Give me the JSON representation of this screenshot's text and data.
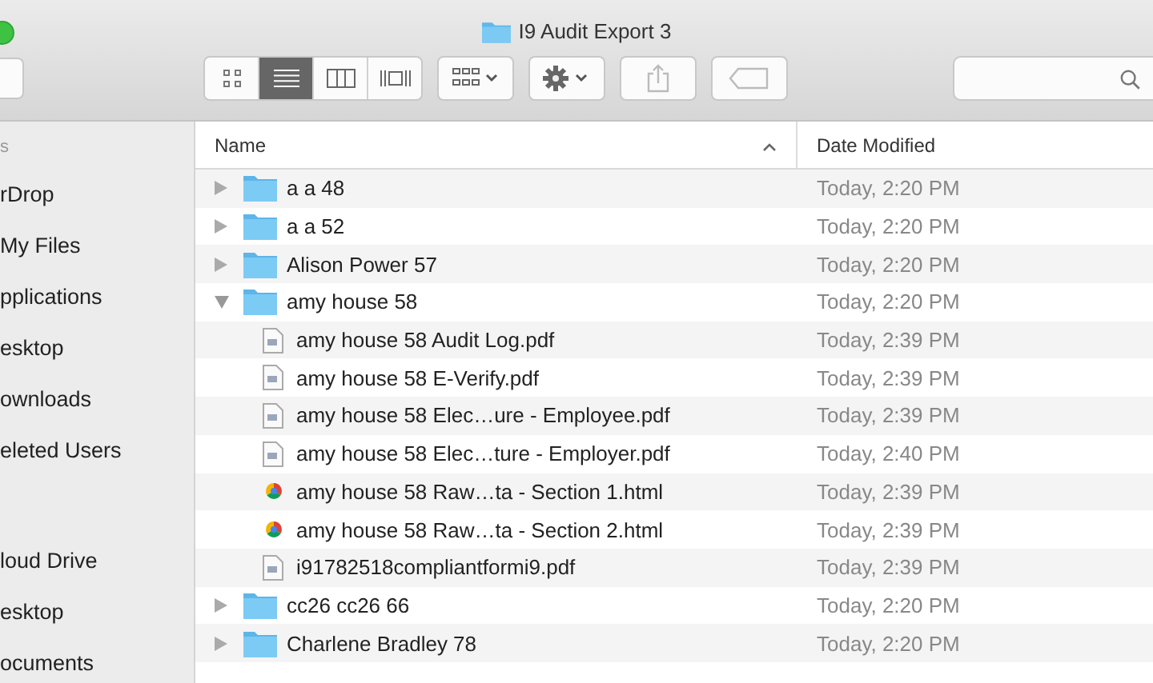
{
  "window": {
    "title": "I9 Audit Export 3"
  },
  "toolbar": {
    "view_modes": [
      {
        "kind": "icons",
        "selected": false
      },
      {
        "kind": "list",
        "selected": true
      },
      {
        "kind": "columns",
        "selected": false
      },
      {
        "kind": "coverflow",
        "selected": false
      }
    ]
  },
  "sidebar": {
    "items": [
      {
        "label": "s",
        "kind": "heading"
      },
      {
        "label": "rDrop",
        "kind": "item"
      },
      {
        "label": "My Files",
        "kind": "item"
      },
      {
        "label": "pplications",
        "kind": "item"
      },
      {
        "label": "esktop",
        "kind": "item"
      },
      {
        "label": "ownloads",
        "kind": "item"
      },
      {
        "label": "eleted Users",
        "kind": "item"
      },
      {
        "kind": "gap"
      },
      {
        "label": "loud Drive",
        "kind": "item"
      },
      {
        "label": "esktop",
        "kind": "item"
      },
      {
        "label": "ocuments",
        "kind": "item"
      }
    ]
  },
  "table": {
    "columns": [
      {
        "label": "Name",
        "sorted": true
      },
      {
        "label": "Date Modified",
        "sorted": false
      }
    ],
    "rows": [
      {
        "name": "a a 48",
        "kind": "folder",
        "expanded": false,
        "date": "Today, 2:20 PM"
      },
      {
        "name": "a a 52",
        "kind": "folder",
        "expanded": false,
        "date": "Today, 2:20 PM"
      },
      {
        "name": "Alison Power 57",
        "kind": "folder",
        "expanded": false,
        "date": "Today, 2:20 PM"
      },
      {
        "name": "amy house 58",
        "kind": "folder",
        "expanded": true,
        "date": "Today, 2:20 PM",
        "children": [
          {
            "name": "amy house 58 Audit Log.pdf",
            "kind": "pdf",
            "date": "Today, 2:39 PM"
          },
          {
            "name": "amy house 58 E-Verify.pdf",
            "kind": "pdf",
            "date": "Today, 2:39 PM"
          },
          {
            "name": "amy house 58 Elec…ure - Employee.pdf",
            "kind": "pdf",
            "date": "Today, 2:39 PM"
          },
          {
            "name": "amy house 58 Elec…ture - Employer.pdf",
            "kind": "pdf",
            "date": "Today, 2:40 PM"
          },
          {
            "name": "amy house 58 Raw…ta - Section 1.html",
            "kind": "html",
            "date": "Today, 2:39 PM"
          },
          {
            "name": "amy house 58 Raw…ta - Section 2.html",
            "kind": "html",
            "date": "Today, 2:39 PM"
          },
          {
            "name": "i91782518compliantformi9.pdf",
            "kind": "pdf",
            "date": "Today, 2:39 PM"
          }
        ]
      },
      {
        "name": "cc26 cc26 66",
        "kind": "folder",
        "expanded": false,
        "date": "Today, 2:20 PM"
      },
      {
        "name": "Charlene Bradley 78",
        "kind": "folder",
        "expanded": false,
        "date": "Today, 2:20 PM"
      }
    ]
  }
}
